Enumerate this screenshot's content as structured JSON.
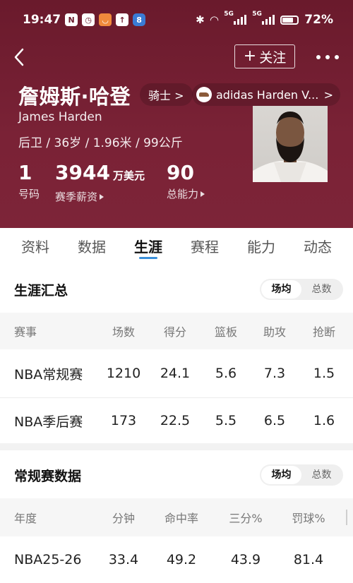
{
  "status_bar": {
    "time": "19:47",
    "icons": [
      "n-icon",
      "alarm-icon",
      "app-icon",
      "upload-icon",
      "app-8-icon"
    ],
    "signal_label_1": "5G",
    "signal_label_2": "5G",
    "battery": "72%",
    "battery_level": 0.72
  },
  "nav": {
    "follow_label": "关注"
  },
  "player": {
    "name_cn": "詹姆斯·哈登",
    "team": "骑士 >",
    "shoe": "adidas Harden V...",
    "shoe_arrow": ">",
    "name_en": "James Harden",
    "meta": "后卫 / 36岁 / 1.96米 / 99公斤",
    "number_value": "1",
    "number_label": "号码",
    "salary_value": "3944",
    "salary_unit": "万美元",
    "salary_label": "赛季薪资",
    "ability_value": "90",
    "ability_label": "总能力"
  },
  "tabs": [
    {
      "label": "资料",
      "active": false
    },
    {
      "label": "数据",
      "active": false
    },
    {
      "label": "生涯",
      "active": true
    },
    {
      "label": "赛程",
      "active": false
    },
    {
      "label": "能力",
      "active": false
    },
    {
      "label": "动态",
      "active": false
    }
  ],
  "career_summary": {
    "title": "生涯汇总",
    "toggle": [
      "场均",
      "总数"
    ],
    "headers": [
      "赛事",
      "场数",
      "得分",
      "篮板",
      "助攻",
      "抢断"
    ],
    "rows": [
      [
        "NBA常规赛",
        "1210",
        "24.1",
        "5.6",
        "7.3",
        "1.5"
      ],
      [
        "NBA季后赛",
        "173",
        "22.5",
        "5.5",
        "6.5",
        "1.6"
      ]
    ]
  },
  "regular_season": {
    "title": "常规赛数据",
    "toggle": [
      "场均",
      "总数"
    ],
    "headers": [
      "年度",
      "分钟",
      "命中率",
      "三分%",
      "罚球%"
    ],
    "rows": [
      [
        "NBA25-26",
        "33.4",
        "49.2",
        "43.9",
        "81.4"
      ]
    ]
  },
  "colors": {
    "hero_bg": "#7a2236",
    "tab_indicator": "#3a8fd9"
  }
}
